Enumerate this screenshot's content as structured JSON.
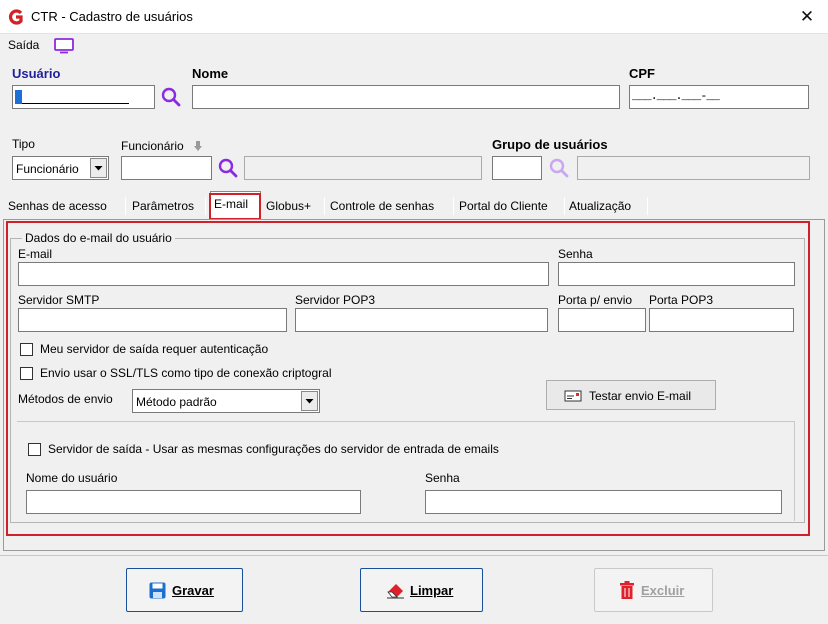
{
  "window": {
    "title": "CTR - Cadastro de usuários",
    "close_glyph": "✕"
  },
  "menu": {
    "saida": "Saída"
  },
  "header_fields": {
    "usuario_label": "Usuário",
    "usuario_value": "",
    "nome_label": "Nome",
    "nome_value": "",
    "cpf_label": "CPF",
    "cpf_mask": "___.___.___-__",
    "tipo_label": "Tipo",
    "tipo_value": "Funcionário",
    "funcionario_label": "Funcionário",
    "grupo_label": "Grupo de usuários"
  },
  "tabs": [
    {
      "label": "Senhas de acesso"
    },
    {
      "label": "Parâmetros"
    },
    {
      "label": "E-mail",
      "active": true
    },
    {
      "label": "Globus+"
    },
    {
      "label": "Controle de senhas"
    },
    {
      "label": "Portal do Cliente"
    },
    {
      "label": "Atualização"
    }
  ],
  "email_tab": {
    "group_title": "Dados do e-mail do usuário",
    "email_label": "E-mail",
    "senha_label": "Senha",
    "smtp_label": "Servidor SMTP",
    "pop3_label": "Servidor POP3",
    "porta_envio_label": "Porta p/ envio",
    "porta_pop3_label": "Porta POP3",
    "auth_checkbox": "Meu servidor de saída requer autenticação",
    "ssl_checkbox": "Envio usar o SSL/TLS como tipo de conexão criptogral",
    "metodos_label": "Métodos de envio",
    "metodos_value": "Método padrão",
    "testar_button": "Testar envio E-mail",
    "servidor_saida_checkbox": "Servidor de saída - Usar as mesmas configurações do servidor de entrada de emails",
    "nome_usuario_label": "Nome do usuário",
    "senha2_label": "Senha"
  },
  "footer": {
    "gravar": "Gravar",
    "limpar": "Limpar",
    "excluir": "Excluir"
  },
  "colors": {
    "accent": "#1f1fa0",
    "highlight": "#d0202a",
    "icon_purple": "#8a2be2"
  }
}
